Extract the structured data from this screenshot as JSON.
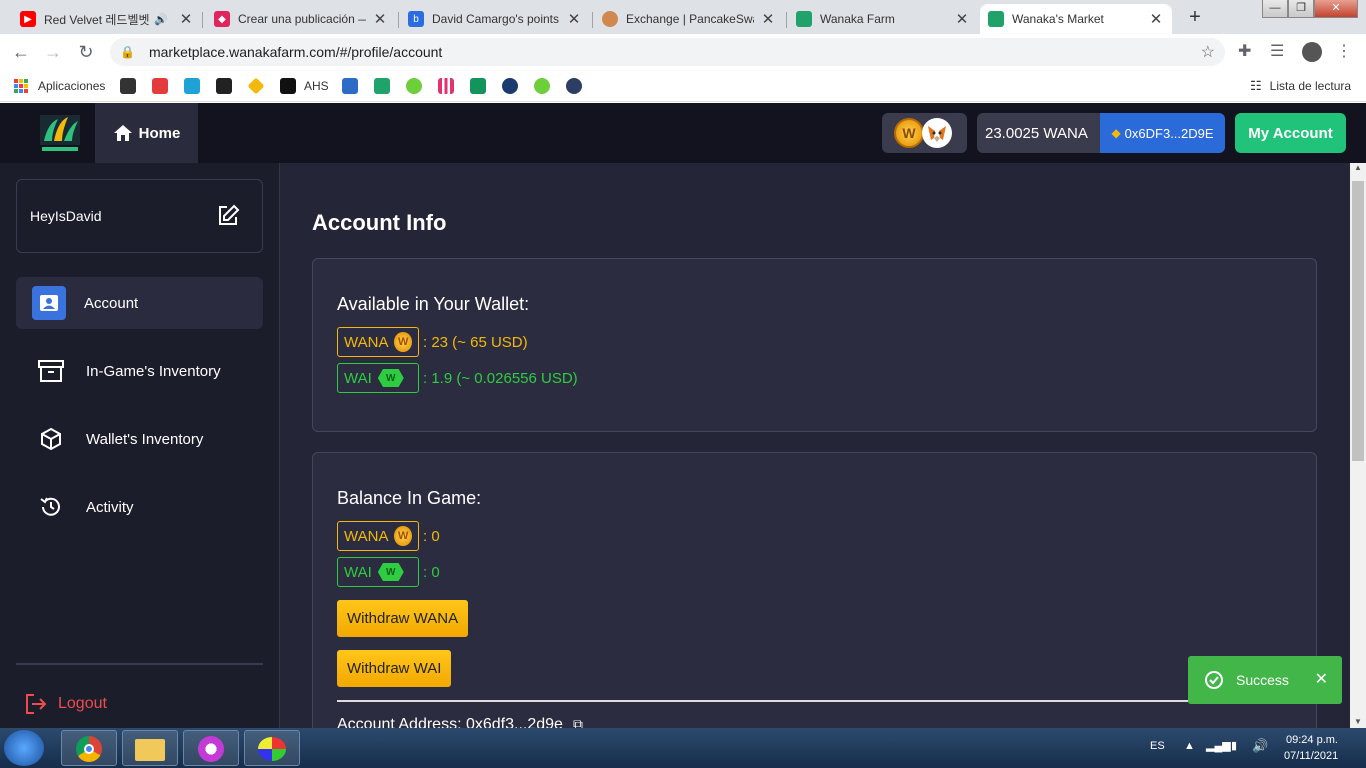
{
  "browser": {
    "tabs": [
      {
        "title": "Red Velvet 레드벨벳",
        "color": "#ff0000"
      },
      {
        "title": "Crear una publicación —",
        "color": "#e0245e"
      },
      {
        "title": "David Camargo's points",
        "color": "#2b6de0"
      },
      {
        "title": "Exchange | PancakeSwap",
        "color": "#d1884f"
      },
      {
        "title": "Wanaka Farm",
        "color": "#1fa36b"
      },
      {
        "title": "Wanaka's Market",
        "color": "#1fa36b"
      }
    ],
    "url": "marketplace.wanakafarm.com/#/profile/account",
    "bookmarks_apps": "Aplicaciones",
    "bookmark_ahs": "AHS",
    "reading_list": "Lista de lectura"
  },
  "header": {
    "home_label": "Home",
    "wana_balance": "23.0025 WANA",
    "wallet_address": "0x6DF3...2D9E",
    "my_account": "My Account"
  },
  "sidebar": {
    "username": "HeyIsDavid",
    "items": [
      {
        "label": "Account",
        "icon": "user-card-icon",
        "active": true
      },
      {
        "label": "In-Game's Inventory",
        "icon": "archive-box-icon",
        "active": false
      },
      {
        "label": "Wallet's Inventory",
        "icon": "cube-icon",
        "active": false
      },
      {
        "label": "Activity",
        "icon": "history-clock-icon",
        "active": false
      }
    ],
    "logout": "Logout"
  },
  "main": {
    "title": "Account Info",
    "wallet": {
      "heading": "Available in Your Wallet:",
      "wana_label": "WANA",
      "wana_value": ": 23 (~ 65 USD)",
      "wai_label": "WAI",
      "wai_value": ": 1.9 (~ 0.026556 USD)"
    },
    "game": {
      "heading": "Balance In Game:",
      "wana_label": "WANA",
      "wana_value": ": 0",
      "wai_label": "WAI",
      "wai_value": ": 0",
      "withdraw_wana": "Withdraw WANA",
      "withdraw_wai": "Withdraw WAI"
    },
    "account_address": "Account Address: 0x6df3...2d9e"
  },
  "toast": {
    "message": "Success"
  },
  "taskbar": {
    "lang": "ES",
    "time": "09:24 p.m.",
    "date": "07/11/2021"
  },
  "colors": {
    "wana": "#f2b90a",
    "wai": "#2ecc40",
    "accent_green": "#21c279",
    "accent_blue": "#2b6ad9",
    "danger": "#ef4c4c"
  }
}
